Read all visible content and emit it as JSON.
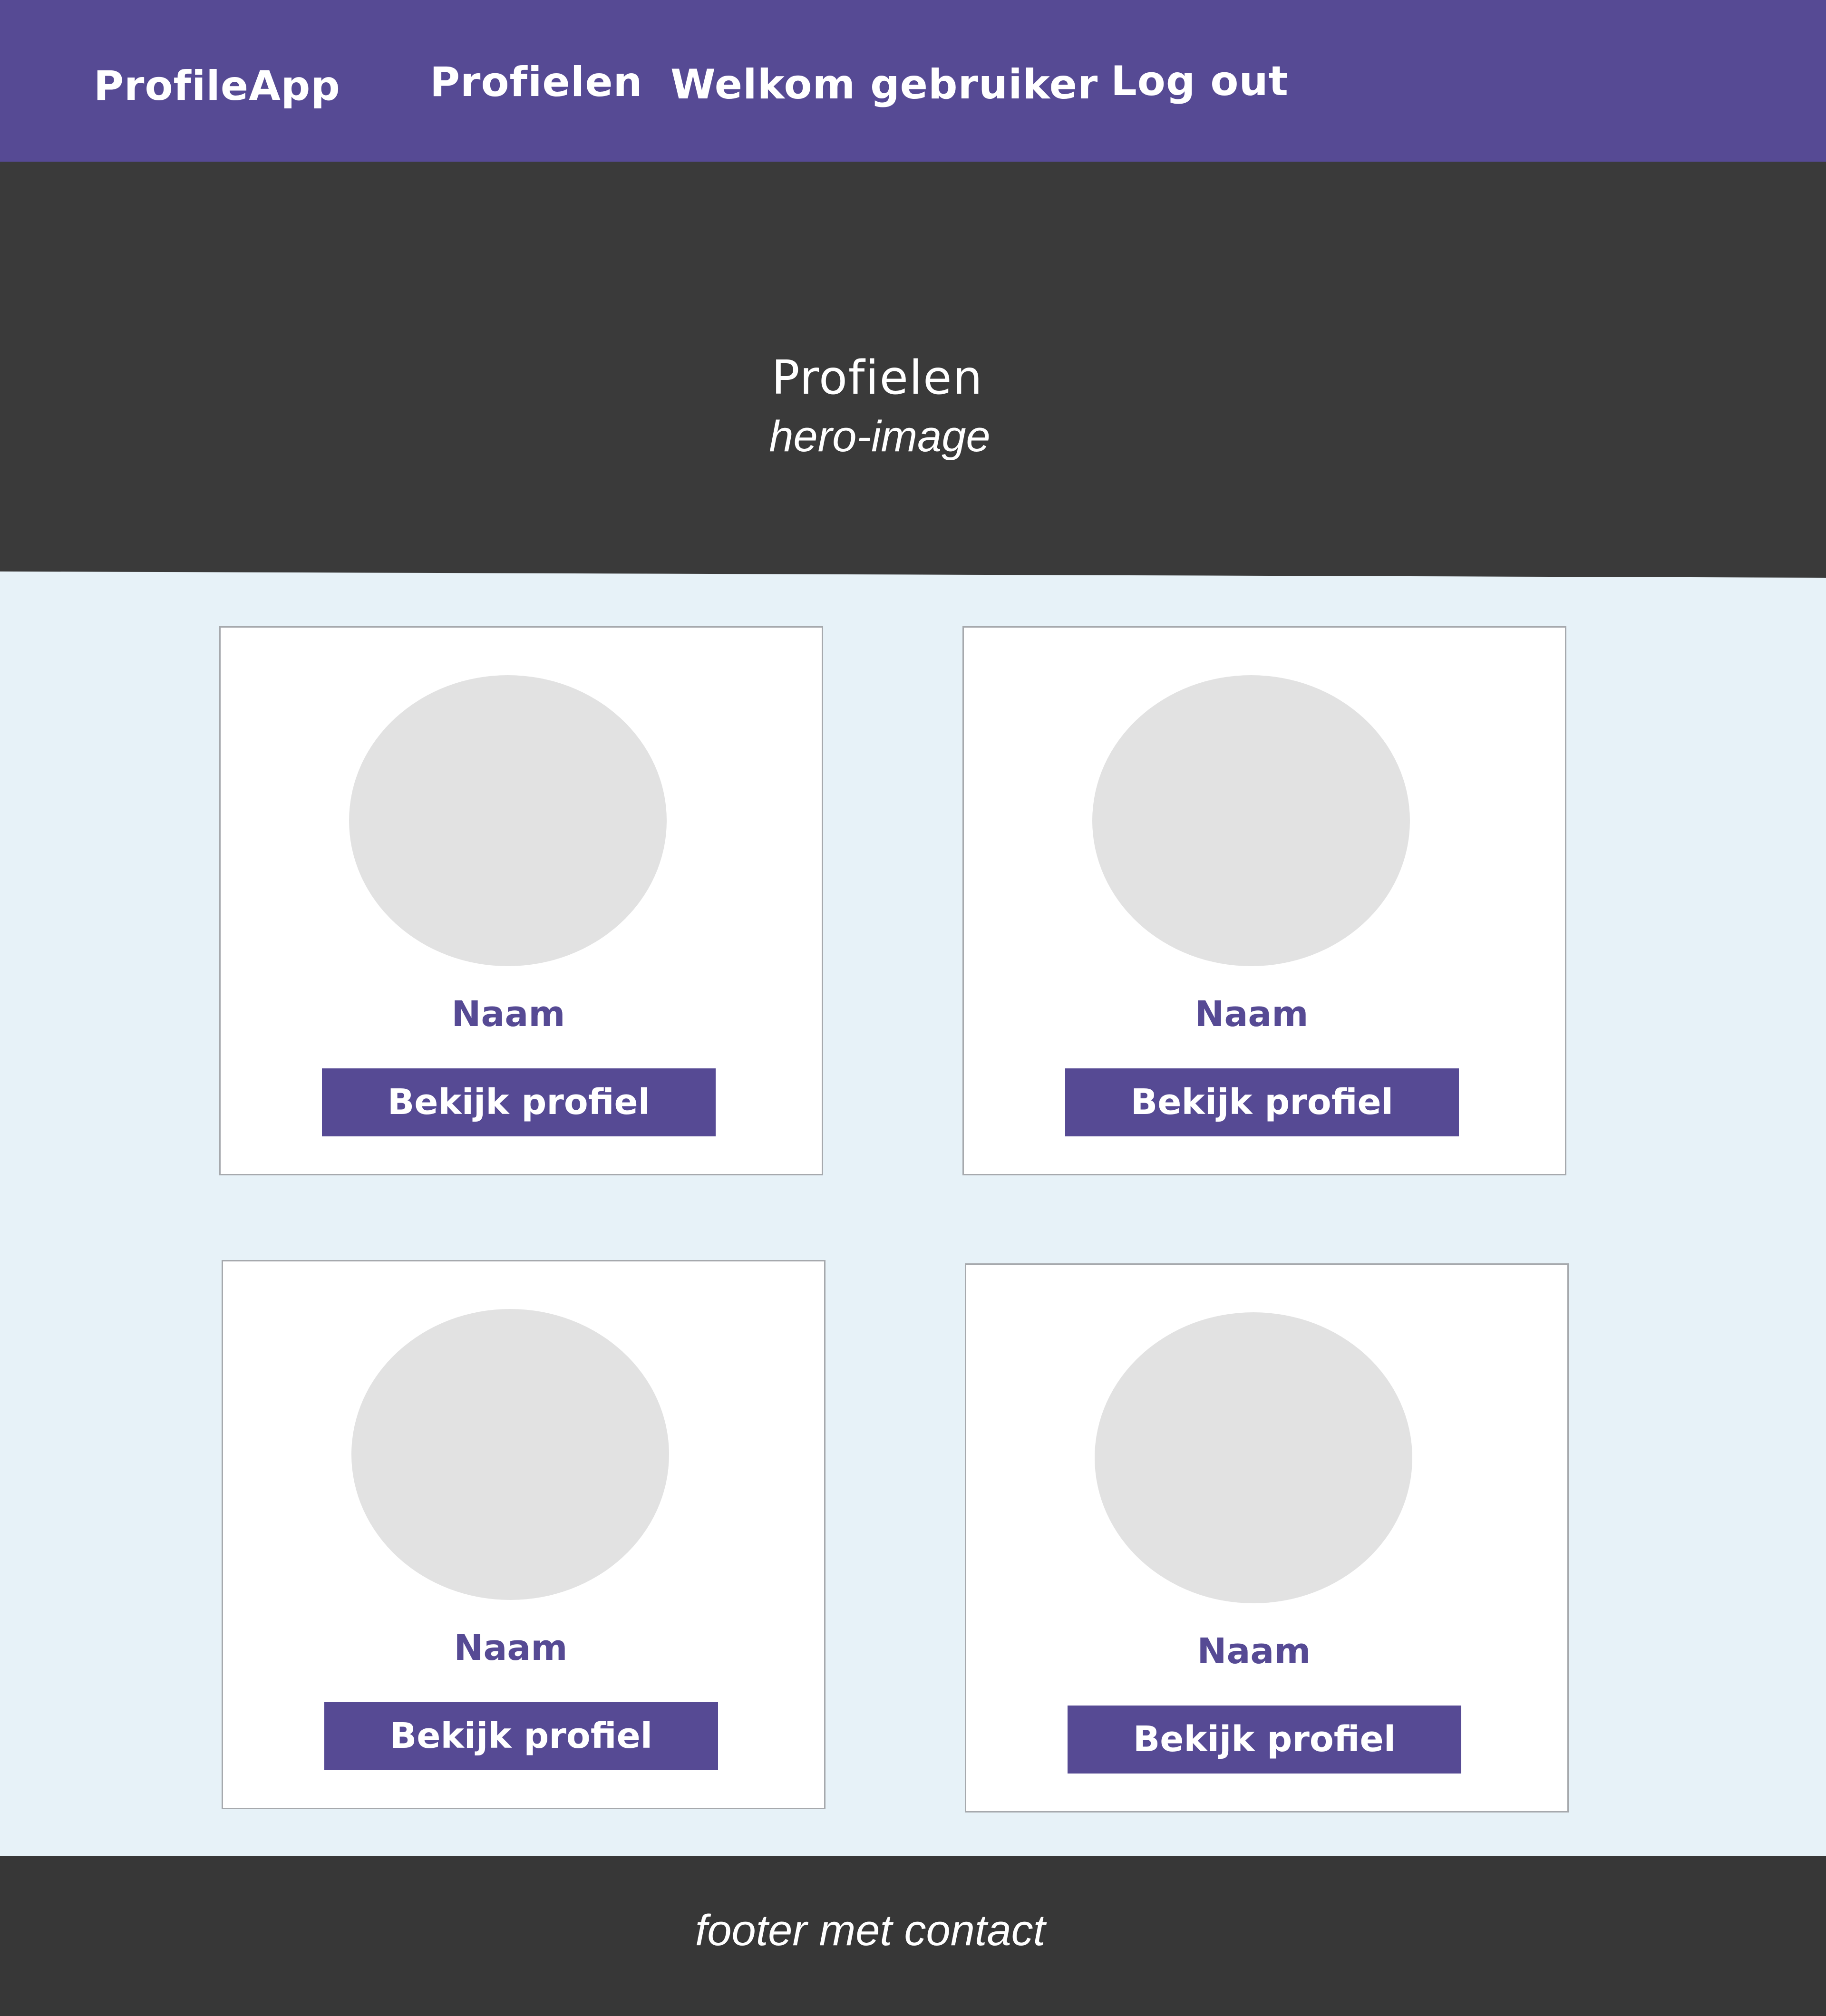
{
  "navbar": {
    "brand": "ProfileApp",
    "links": {
      "profielen": "Profielen",
      "welkom": "Welkom gebruiker",
      "logout": "Log out"
    }
  },
  "hero": {
    "title": "Profielen",
    "subtitle": "hero-image"
  },
  "profiles": [
    {
      "name": "Naam",
      "button_label": "Bekijk profiel"
    },
    {
      "name": "Naam",
      "button_label": "Bekijk profiel"
    },
    {
      "name": "Naam",
      "button_label": "Bekijk profiel"
    },
    {
      "name": "Naam",
      "button_label": "Bekijk profiel"
    }
  ],
  "footer": {
    "text": "footer met contact"
  },
  "colors": {
    "primary": "#564a94",
    "hero_background": "#3a3a3a",
    "page_background": "#e7f2f8",
    "footer_background": "#373737",
    "avatar_placeholder": "#e2e2e2"
  }
}
